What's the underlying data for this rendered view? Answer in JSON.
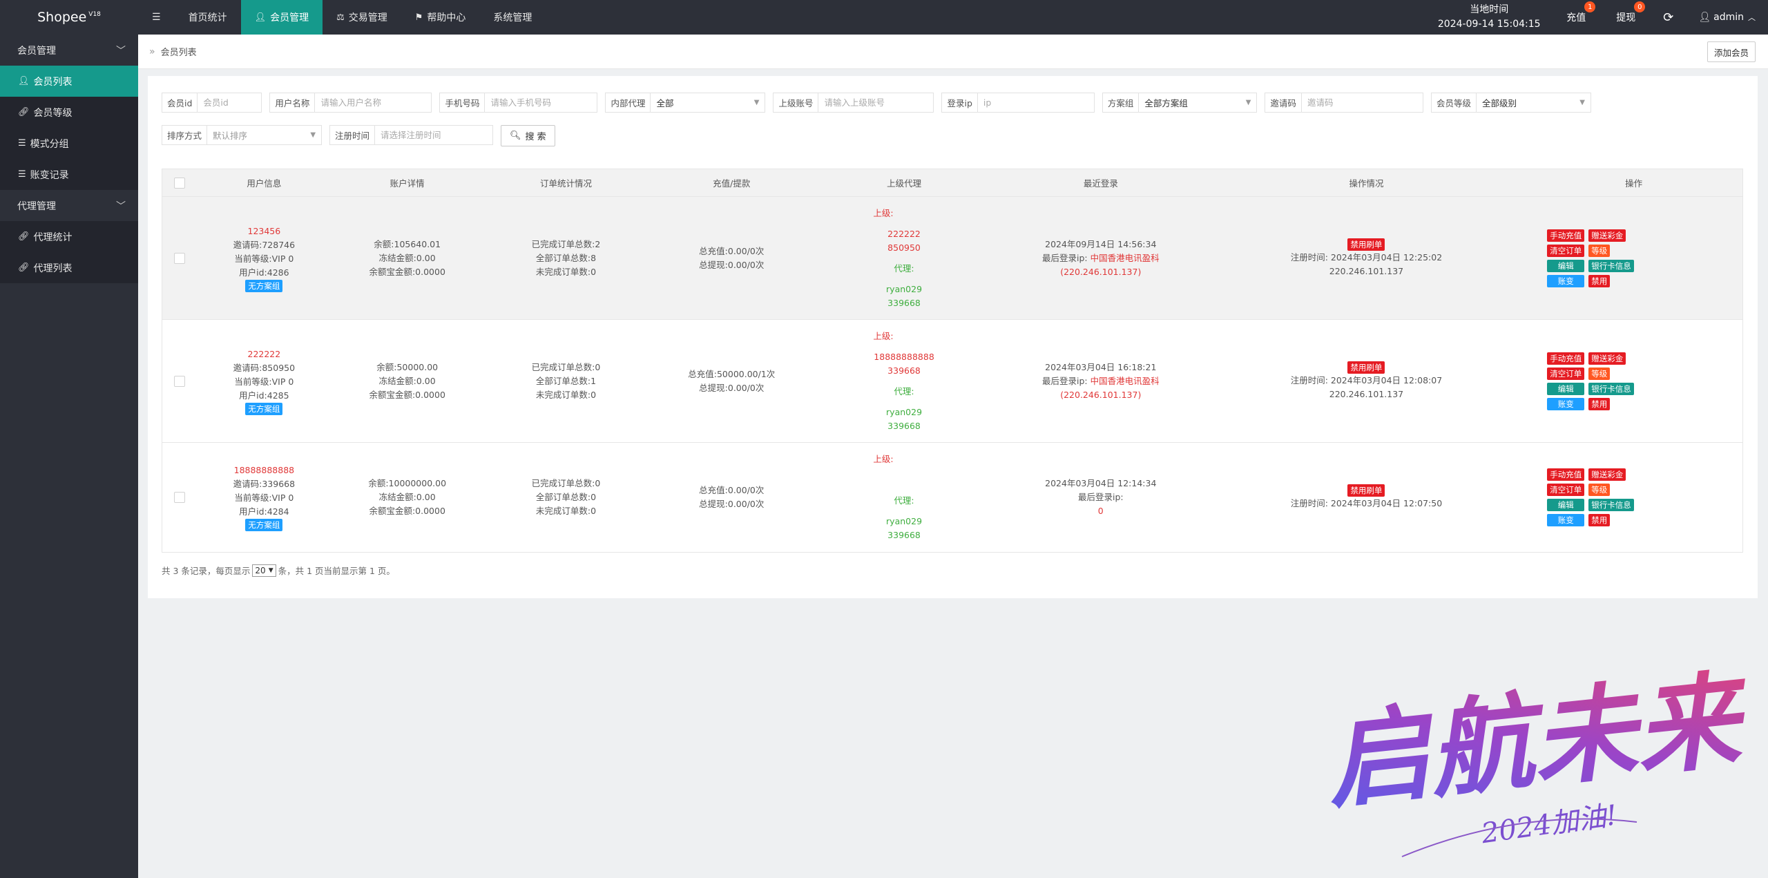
{
  "app": {
    "name": "Shopee",
    "version": "V18"
  },
  "topnav": [
    {
      "label": "首页统计",
      "icon": ""
    },
    {
      "label": "会员管理",
      "icon": "user-icon",
      "active": true
    },
    {
      "label": "交易管理",
      "icon": "balance-icon"
    },
    {
      "label": "帮助中心",
      "icon": "flag-icon"
    },
    {
      "label": "系统管理",
      "icon": ""
    }
  ],
  "topright": {
    "time_label": "当地时间",
    "time_value": "2024-09-14 15:04:15",
    "recharge_label": "充值",
    "recharge_badge": "1",
    "withdraw_label": "提现",
    "withdraw_badge": "0",
    "user": "admin"
  },
  "sidebar": {
    "groups": [
      {
        "label": "会员管理",
        "items": [
          {
            "label": "会员列表",
            "icon": "user-icon",
            "active": true
          },
          {
            "label": "会员等级",
            "icon": "link-icon"
          },
          {
            "label": "模式分组",
            "icon": "list-icon"
          },
          {
            "label": "账变记录",
            "icon": "list-icon"
          }
        ]
      },
      {
        "label": "代理管理",
        "items": [
          {
            "label": "代理统计",
            "icon": "link-icon"
          },
          {
            "label": "代理列表",
            "icon": "link-icon"
          }
        ]
      }
    ]
  },
  "breadcrumb": {
    "sep": "»",
    "current": "会员列表"
  },
  "add_button": "添加会员",
  "filters": {
    "member_id": {
      "label": "会员id",
      "placeholder": "会员id"
    },
    "username": {
      "label": "用户名称",
      "placeholder": "请输入用户名称"
    },
    "phone": {
      "label": "手机号码",
      "placeholder": "请输入手机号码"
    },
    "internal_agent": {
      "label": "内部代理",
      "value": "全部"
    },
    "superior": {
      "label": "上级账号",
      "placeholder": "请输入上级账号"
    },
    "login_ip": {
      "label": "登录ip",
      "placeholder": "ip"
    },
    "plan_group": {
      "label": "方案组",
      "value": "全部方案组"
    },
    "invite_code": {
      "label": "邀请码",
      "placeholder": "邀请码"
    },
    "member_level": {
      "label": "会员等级",
      "value": "全部级别"
    },
    "sort": {
      "label": "排序方式",
      "value": "默认排序"
    },
    "reg_time": {
      "label": "注册时间",
      "placeholder": "请选择注册时间"
    },
    "search_button": "搜 索"
  },
  "table": {
    "headers": [
      "用户信息",
      "账户详情",
      "订单统计情况",
      "充值/提款",
      "上级代理",
      "最近登录",
      "操作情况",
      "操作"
    ],
    "rows": [
      {
        "username": "123456",
        "invite": "邀请码:728746",
        "level": "当前等级:VIP 0",
        "uid": "用户id:4286",
        "group_tag": "无方案组",
        "balance": "余额:105640.01",
        "frozen": "冻结金额:0.00",
        "yuebao": "余额宝金额:0.0000",
        "done_orders": "已完成订单总数:2",
        "all_orders": "全部订单总数:8",
        "undone_orders": "未完成订单数:0",
        "total_recharge": "总充值:0.00/0次",
        "total_withdraw": "总提现:0.00/0次",
        "sup_label": "上级:",
        "sup_lines": [
          "222222",
          "850950"
        ],
        "agent_label": "代理:",
        "agent_lines": [
          "ryan029",
          "339668"
        ],
        "last_login_time": "2024年09月14日 14:56:34",
        "last_ip_label": "最后登录ip:",
        "last_ip_loc": "中国香港电讯盈科",
        "last_ip": "(220.246.101.137)",
        "ban_tag": "禁用刷单",
        "reg_label": "注册时间:",
        "reg_time": "2024年03月04日 12:25:02",
        "reg_ip": "220.246.101.137"
      },
      {
        "username": "222222",
        "invite": "邀请码:850950",
        "level": "当前等级:VIP 0",
        "uid": "用户id:4285",
        "group_tag": "无方案组",
        "balance": "余额:50000.00",
        "frozen": "冻结金额:0.00",
        "yuebao": "余额宝金额:0.0000",
        "done_orders": "已完成订单总数:0",
        "all_orders": "全部订单总数:1",
        "undone_orders": "未完成订单数:0",
        "total_recharge": "总充值:50000.00/1次",
        "total_withdraw": "总提现:0.00/0次",
        "sup_label": "上级:",
        "sup_lines": [
          "18888888888",
          "339668"
        ],
        "agent_label": "代理:",
        "agent_lines": [
          "ryan029",
          "339668"
        ],
        "last_login_time": "2024年03月04日 16:18:21",
        "last_ip_label": "最后登录ip:",
        "last_ip_loc": "中国香港电讯盈科",
        "last_ip": "(220.246.101.137)",
        "ban_tag": "禁用刷单",
        "reg_label": "注册时间:",
        "reg_time": "2024年03月04日 12:08:07",
        "reg_ip": "220.246.101.137"
      },
      {
        "username": "18888888888",
        "invite": "邀请码:339668",
        "level": "当前等级:VIP 0",
        "uid": "用户id:4284",
        "group_tag": "无方案组",
        "balance": "余额:10000000.00",
        "frozen": "冻结金额:0.00",
        "yuebao": "余额宝金额:0.0000",
        "done_orders": "已完成订单总数:0",
        "all_orders": "全部订单总数:0",
        "undone_orders": "未完成订单数:0",
        "total_recharge": "总充值:0.00/0次",
        "total_withdraw": "总提现:0.00/0次",
        "sup_label": "上级:",
        "sup_lines": [],
        "agent_label": "代理:",
        "agent_lines": [
          "ryan029",
          "339668"
        ],
        "last_login_time": "2024年03月04日 12:14:34",
        "last_ip_label": "最后登录ip:",
        "last_ip_loc": "",
        "last_ip": "0",
        "ban_tag": "禁用刷单",
        "reg_label": "注册时间:",
        "reg_time": "2024年03月04日 12:07:50",
        "reg_ip": ""
      }
    ],
    "ops": {
      "manual_recharge": "手动充值",
      "gift": "赠送彩金",
      "clear_orders": "清空订单",
      "level": "等级",
      "edit": "编辑",
      "bank": "银行卡信息",
      "account_change": "账变",
      "disable": "禁用"
    }
  },
  "pager": {
    "prefix": "共 3 条记录，每页显示",
    "page_size": "20",
    "suffix": "条，共 1 页当前显示第 1 页。"
  },
  "watermark": {
    "main": "启航未来",
    "sub": "2024加油!"
  },
  "colors": {
    "primary": "#159a8c",
    "dark": "#2d3039",
    "red": "#e51c23",
    "blue": "#1e9fff"
  }
}
